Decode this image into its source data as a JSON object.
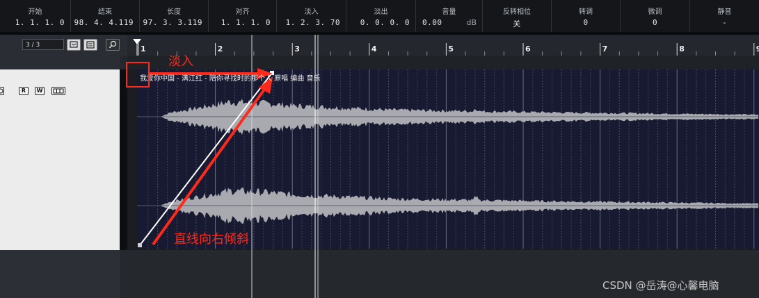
{
  "info_bar": {
    "fields": [
      {
        "label": "开始",
        "value": "1. 1. 1.   0"
      },
      {
        "label": "结束",
        "value": "98. 4. 4.119"
      },
      {
        "label": "长度",
        "value": "97. 3. 3.119"
      },
      {
        "label": "对齐",
        "value": "1. 1. 1.   0"
      },
      {
        "label": "淡入",
        "value": "1. 2. 3. 70"
      },
      {
        "label": "淡出",
        "value": "0. 0. 0.   0"
      },
      {
        "label": "音量",
        "value": "0.00",
        "unit": "dB"
      },
      {
        "label": "反转相位",
        "value": "关"
      },
      {
        "label": "转调",
        "value": "0"
      },
      {
        "label": "微调",
        "value": "0"
      },
      {
        "label": "静音",
        "value": "-"
      }
    ]
  },
  "toolbar": {
    "track_count": "3 / 3"
  },
  "track_header": {
    "read_label": "R",
    "write_label": "W"
  },
  "ruler": {
    "bars": [
      "1",
      "2",
      "3",
      "4",
      "5",
      "6",
      "7",
      "8",
      "9"
    ]
  },
  "audio_event": {
    "title": "我爱你中国 - 满江红 - 陪你寻找时的那个人 原唱 编曲 音乐"
  },
  "annotations": {
    "fade_label": "淡入",
    "tilt_label": "直线向右倾斜",
    "annotation_color": "#ff2a1a"
  },
  "watermark": "CSDN @岳涛@心馨电脑",
  "colors": {
    "event_bg": "#181a32",
    "waveform": "#a9aab0",
    "ruler_bg": "#24272d"
  }
}
